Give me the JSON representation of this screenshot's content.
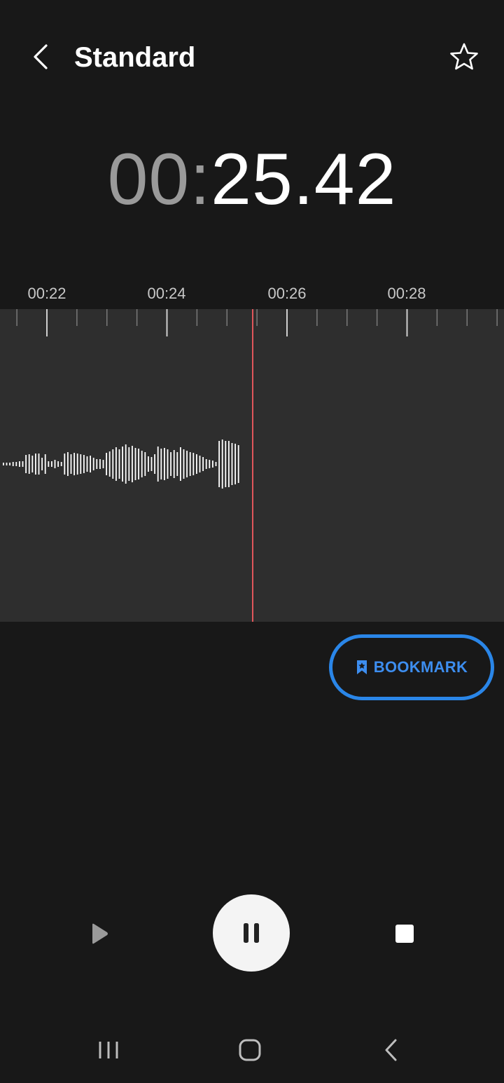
{
  "header": {
    "title": "Standard",
    "back_icon": "chevron-left-icon",
    "favorite_icon": "star-outline-icon"
  },
  "timer": {
    "minutes": "00",
    "separator": ":",
    "rest": "25.42"
  },
  "timeline": {
    "labels": [
      "00:22",
      "00:24",
      "00:26",
      "00:28"
    ]
  },
  "waveform": {
    "playhead_color": "#e0565b",
    "bar_color": "#ffffff",
    "panel_color": "#2e2e2e"
  },
  "bookmark": {
    "label": "BOOKMARK",
    "icon": "bookmark-star-icon",
    "accent_color": "#2a86e8"
  },
  "controls": {
    "play_icon": "play-icon",
    "pause_icon": "pause-icon",
    "stop_icon": "stop-icon"
  },
  "navbar": {
    "recents_icon": "recents-icon",
    "home_icon": "home-icon",
    "back_icon": "nav-back-icon"
  }
}
